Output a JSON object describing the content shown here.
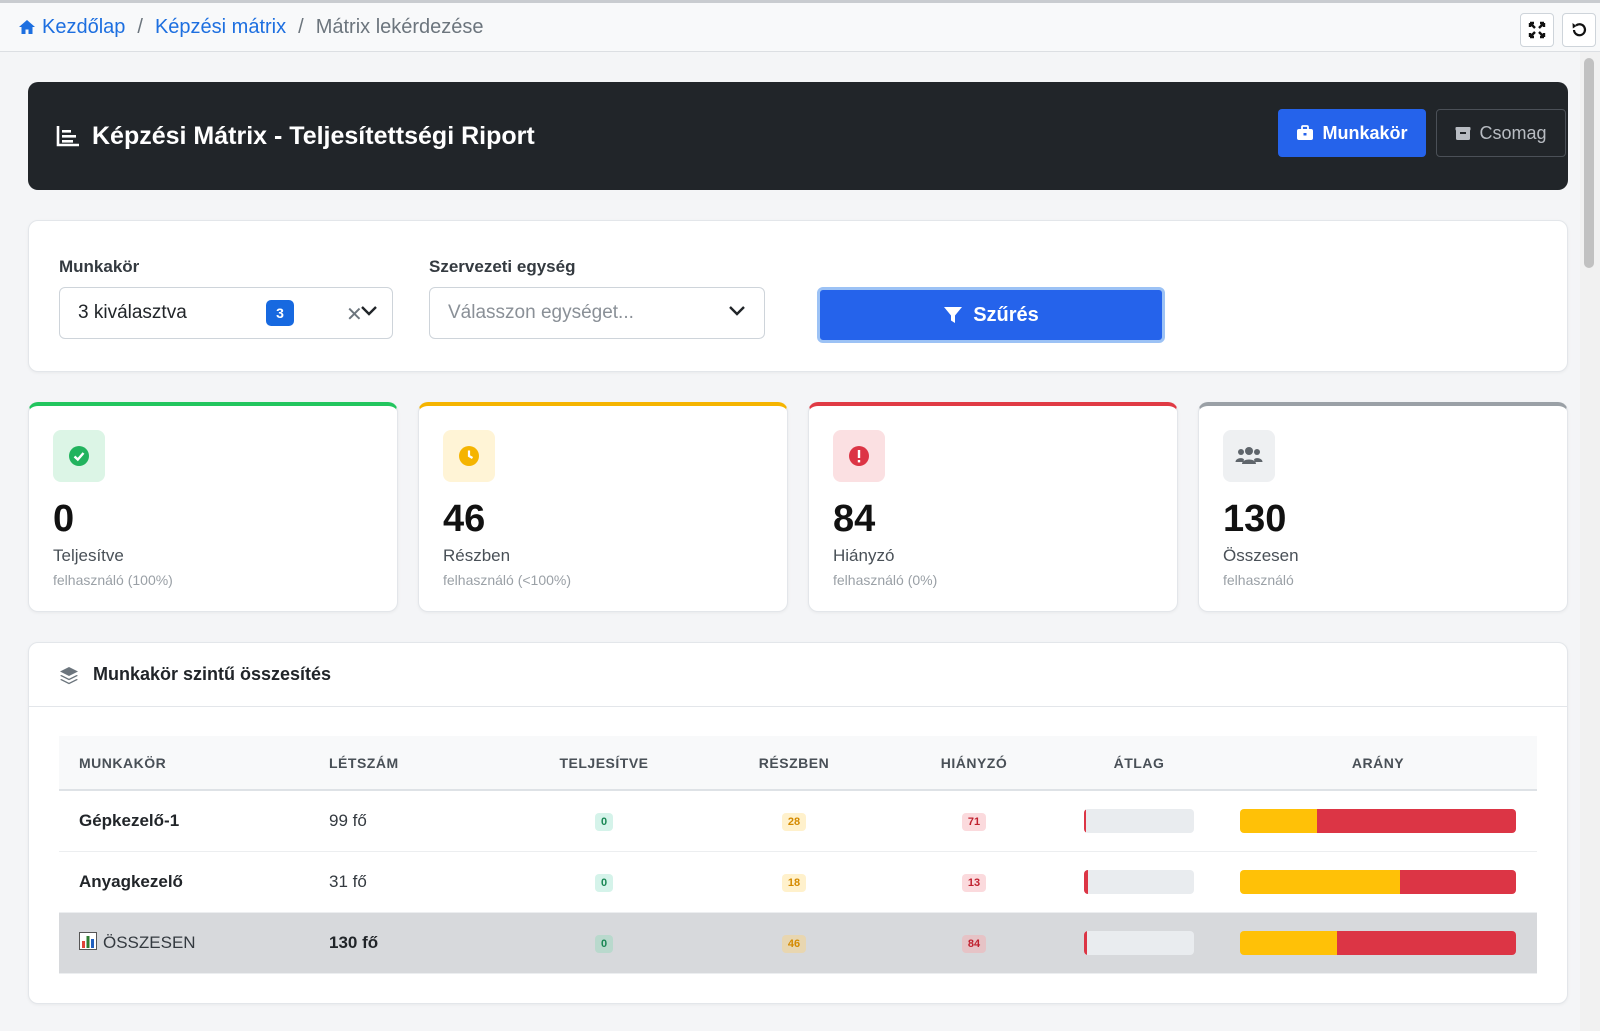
{
  "breadcrumb": {
    "home": "Kezdőlap",
    "section": "Képzési mátrix",
    "current": "Mátrix lekérdezése"
  },
  "header": {
    "title": "Képzési Mátrix - Teljesítettségi Riport",
    "btn_munkakor": "Munkakör",
    "btn_csomag": "Csomag"
  },
  "filters": {
    "munkakor_label": "Munkakör",
    "munkakor_value": "3 kiválasztva",
    "munkakor_count": "3",
    "egyseg_label": "Szervezeti egység",
    "egyseg_placeholder": "Válasszon egységet...",
    "filter_button": "Szűrés"
  },
  "stats": [
    {
      "value": "0",
      "label": "Teljesítve",
      "sub": "felhasználó (100%)",
      "color": "#22c55e"
    },
    {
      "value": "46",
      "label": "Részben",
      "sub": "felhasználó (<100%)",
      "color": "#f5b400"
    },
    {
      "value": "84",
      "label": "Hiányzó",
      "sub": "felhasználó (0%)",
      "color": "#e03a44"
    },
    {
      "value": "130",
      "label": "Összesen",
      "sub": "felhasználó",
      "color": "#9aa0a6"
    }
  ],
  "summary": {
    "title": "Munkakör szintű összesítés",
    "columns": [
      "MUNKAKÖR",
      "LÉTSZÁM",
      "TELJESÍTVE",
      "RÉSZBEN",
      "HIÁNYZÓ",
      "ÁTLAG",
      "ARÁNY"
    ],
    "rows": [
      {
        "name": "Gépkezelő-1",
        "count": "99 fő",
        "done": "0",
        "partial": "28",
        "missing": "71",
        "avg_fraction": 0.02,
        "ratio_partial": 0.28
      },
      {
        "name": "Anyagkezelő",
        "count": "31 fő",
        "done": "0",
        "partial": "18",
        "missing": "13",
        "avg_fraction": 0.04,
        "ratio_partial": 0.58
      }
    ],
    "total": {
      "name": "ÖSSZESEN",
      "count": "130 fő",
      "done": "0",
      "partial": "46",
      "missing": "84",
      "avg_fraction": 0.03,
      "ratio_partial": 0.35
    }
  }
}
